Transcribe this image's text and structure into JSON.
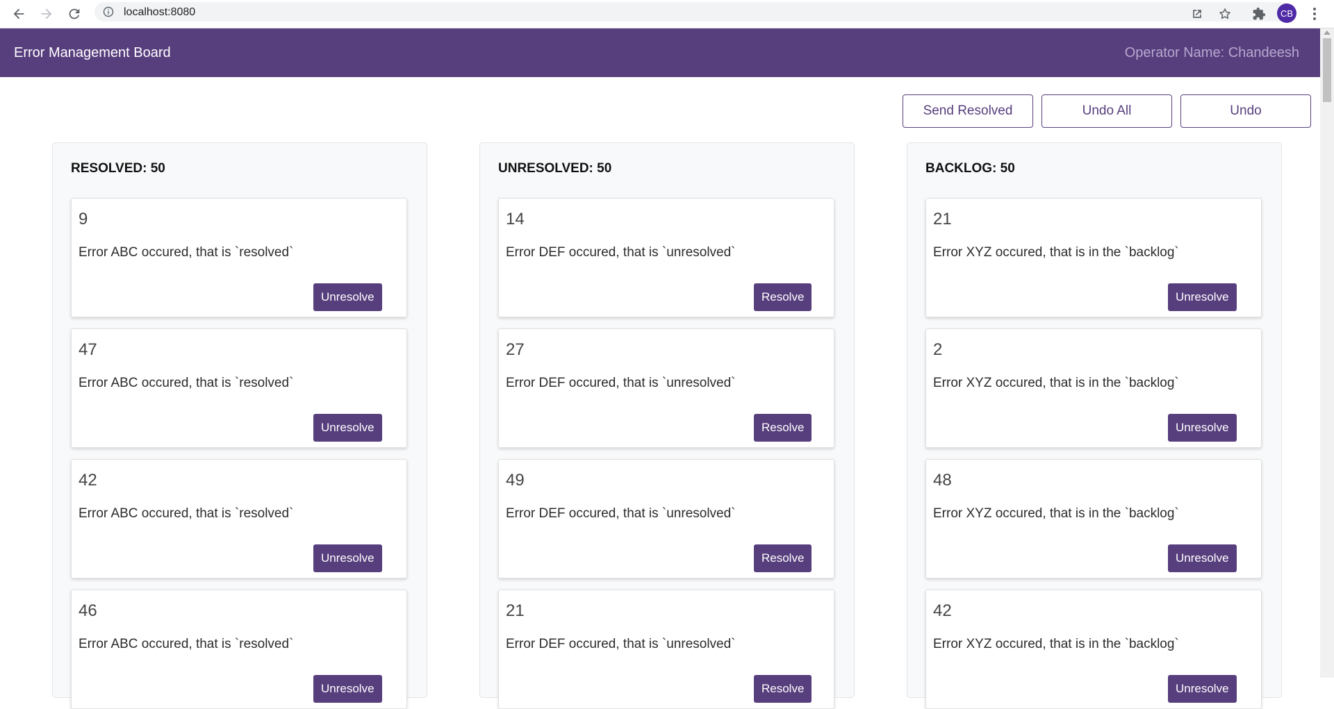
{
  "browser": {
    "url": "localhost:8080",
    "avatar_initials": "CB"
  },
  "header": {
    "title": "Error Management Board",
    "operator": "Operator Name: Chandeesh"
  },
  "actions": {
    "send_resolved": "Send Resolved",
    "undo_all": "Undo All",
    "undo": "Undo"
  },
  "columns": [
    {
      "title": "RESOLVED: 50",
      "cards": [
        {
          "id": "9",
          "text": "Error ABC occured, that is `resolved`",
          "button": "Unresolve"
        },
        {
          "id": "47",
          "text": "Error ABC occured, that is `resolved`",
          "button": "Unresolve"
        },
        {
          "id": "42",
          "text": "Error ABC occured, that is `resolved`",
          "button": "Unresolve"
        },
        {
          "id": "46",
          "text": "Error ABC occured, that is `resolved`",
          "button": "Unresolve"
        }
      ]
    },
    {
      "title": "UNRESOLVED: 50",
      "cards": [
        {
          "id": "14",
          "text": "Error DEF occured, that is `unresolved`",
          "button": "Resolve"
        },
        {
          "id": "27",
          "text": "Error DEF occured, that is `unresolved`",
          "button": "Resolve"
        },
        {
          "id": "49",
          "text": "Error DEF occured, that is `unresolved`",
          "button": "Resolve"
        },
        {
          "id": "21",
          "text": "Error DEF occured, that is `unresolved`",
          "button": "Resolve"
        }
      ]
    },
    {
      "title": "BACKLOG: 50",
      "cards": [
        {
          "id": "21",
          "text": "Error XYZ occured, that is in the `backlog`",
          "button": "Unresolve"
        },
        {
          "id": "2",
          "text": "Error XYZ occured, that is in the `backlog`",
          "button": "Unresolve"
        },
        {
          "id": "48",
          "text": "Error XYZ occured, that is in the `backlog`",
          "button": "Unresolve"
        },
        {
          "id": "42",
          "text": "Error XYZ occured, that is in the `backlog`",
          "button": "Unresolve"
        }
      ]
    }
  ],
  "colors": {
    "brand": "#573e7d",
    "operator_text": "#b8a9cf",
    "column_bg": "#f8f9fa"
  }
}
